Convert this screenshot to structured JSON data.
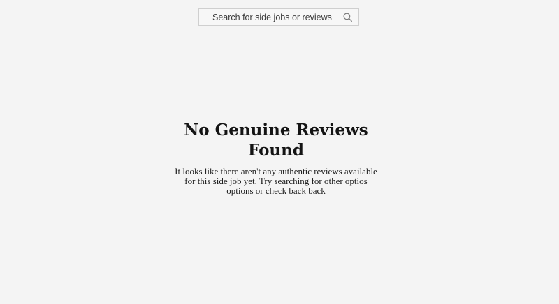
{
  "search": {
    "placeholder": "Search for side jobs or reviews",
    "icon": "search-icon"
  },
  "empty_state": {
    "title": "No Genuine Reviews Found",
    "message": "It looks like there aren't any authentic reviews available for this side job yet. Try searching for other optios options or check back back"
  },
  "colors": {
    "background": "#f4f4f4",
    "text": "#141414",
    "border": "#cfcfcf"
  }
}
